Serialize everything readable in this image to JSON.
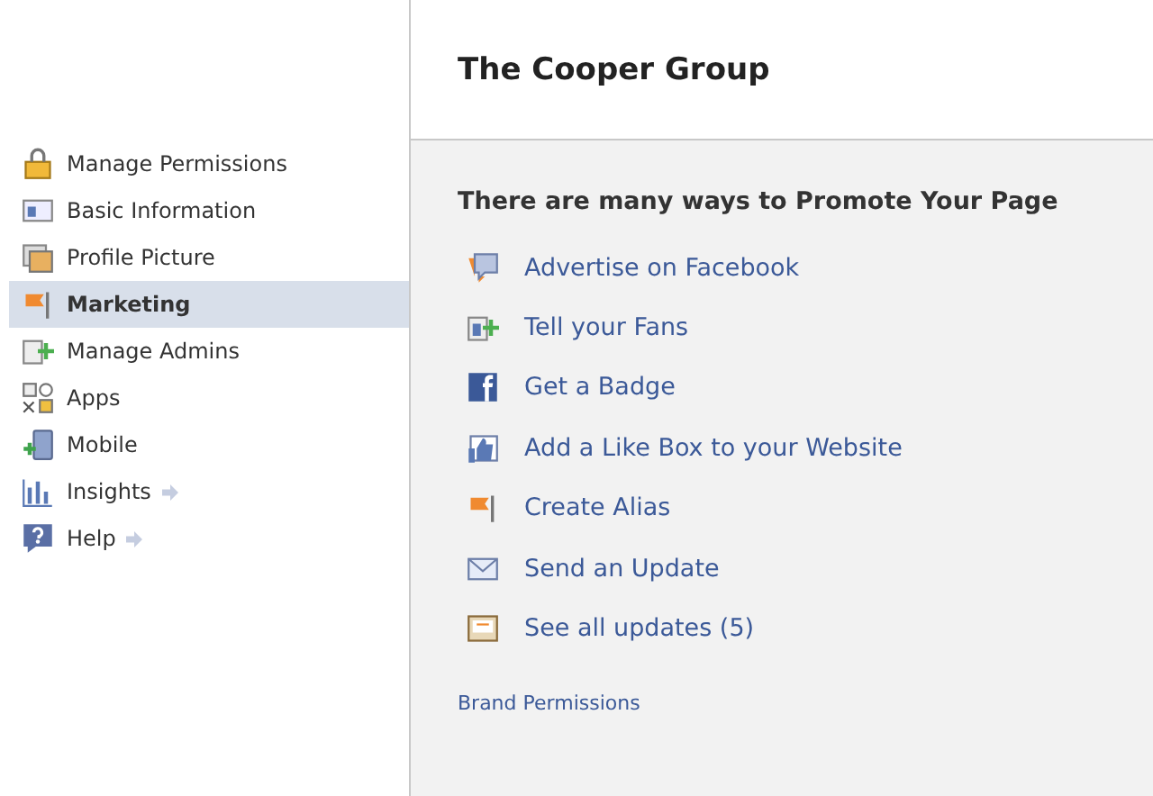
{
  "sidebar": {
    "items": [
      {
        "label": "Manage Permissions",
        "selected": false,
        "arrow": false
      },
      {
        "label": "Basic Information",
        "selected": false,
        "arrow": false
      },
      {
        "label": "Profile Picture",
        "selected": false,
        "arrow": false
      },
      {
        "label": "Marketing",
        "selected": true,
        "arrow": false
      },
      {
        "label": "Manage Admins",
        "selected": false,
        "arrow": false
      },
      {
        "label": "Apps",
        "selected": false,
        "arrow": false
      },
      {
        "label": "Mobile",
        "selected": false,
        "arrow": false
      },
      {
        "label": "Insights",
        "selected": false,
        "arrow": true
      },
      {
        "label": "Help",
        "selected": false,
        "arrow": true
      }
    ]
  },
  "page": {
    "title": "The Cooper Group",
    "heading": "There are many ways to Promote Your Page",
    "links": [
      {
        "label": "Advertise on Facebook"
      },
      {
        "label": "Tell your Fans"
      },
      {
        "label": "Get a Badge"
      },
      {
        "label": "Add a Like Box to your Website"
      },
      {
        "label": "Create Alias"
      },
      {
        "label": "Send an Update"
      },
      {
        "label": "See all updates (5)"
      }
    ],
    "footer_link": "Brand Permissions"
  }
}
